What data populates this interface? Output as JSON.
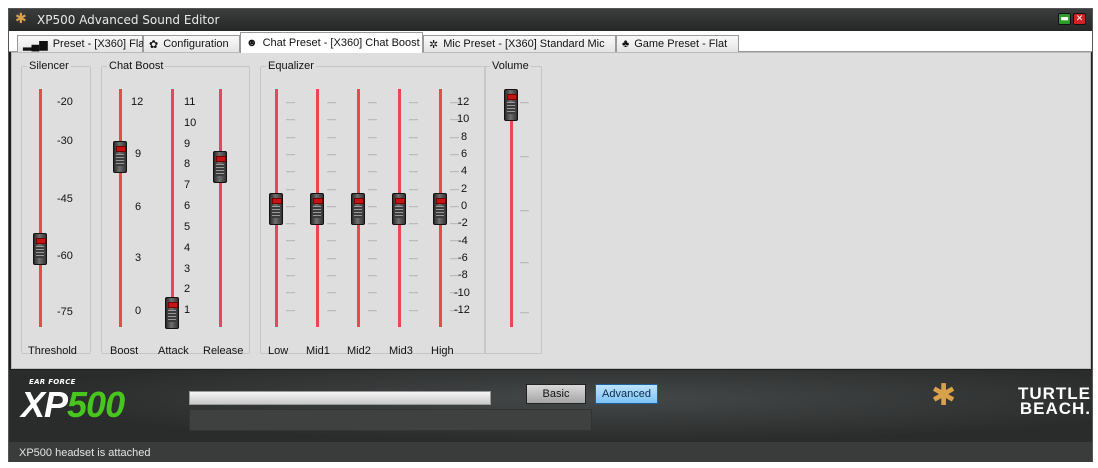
{
  "window": {
    "title": "XP500 Advanced Sound Editor",
    "app_icon": "palm-tree-icon",
    "minimize_icon": "minimize-icon",
    "close_icon": "close-icon",
    "close_glyph": "✕",
    "min_glyph": "▬"
  },
  "tabs": [
    {
      "label": "Preset - [X360] Flat",
      "icon": "equalizer-bars-icon",
      "glyph": "▂▄▆",
      "active": false
    },
    {
      "label": "Configuration",
      "icon": "gear-icon",
      "glyph": "✿",
      "active": false
    },
    {
      "label": "Chat Preset - [X360] Chat Boost",
      "icon": "head-talking-icon",
      "glyph": "☻",
      "active": true
    },
    {
      "label": "Mic Preset - [X360] Standard Mic",
      "icon": "mic-gear-icon",
      "glyph": "✲",
      "active": false
    },
    {
      "label": "Game Preset - Flat",
      "icon": "gamepad-icon",
      "glyph": "♣",
      "active": false
    }
  ],
  "silencer": {
    "legend": "Silencer",
    "ticks": [
      "-20",
      "-30",
      "-45",
      "-60",
      "-75"
    ],
    "threshold": {
      "label": "Threshold",
      "value": -58
    }
  },
  "chat_boost": {
    "legend": "Chat Boost",
    "boost_ticks": [
      "12",
      "9",
      "6",
      "3",
      "0"
    ],
    "attack_ticks": [
      "11",
      "10",
      "9",
      "8",
      "7",
      "6",
      "5",
      "4",
      "3",
      "2",
      "1"
    ],
    "boost": {
      "label": "Boost",
      "value": 9
    },
    "attack": {
      "label": "Attack",
      "value": 1
    },
    "release": {
      "label": "Release",
      "value": 8
    }
  },
  "equalizer": {
    "legend": "Equalizer",
    "ticks": [
      "12",
      "10",
      "8",
      "6",
      "4",
      "2",
      "0",
      "-2",
      "-4",
      "-6",
      "-8",
      "-10",
      "-12"
    ],
    "bands": [
      {
        "label": "Low",
        "value": 0
      },
      {
        "label": "Mid1",
        "value": 0
      },
      {
        "label": "Mid2",
        "value": 0
      },
      {
        "label": "Mid3",
        "value": 0
      },
      {
        "label": "High",
        "value": 0
      }
    ]
  },
  "volume": {
    "legend": "Volume",
    "value": 1.0
  },
  "controls": {
    "basic_label": "Basic",
    "advanced_label": "Advanced",
    "progress_fraction": 0
  },
  "branding": {
    "earforce_text": "EAR FORCE",
    "xp_text": "XP",
    "model_number": "500",
    "turtle_text": "TURTLE",
    "beach_text": "BEACH.",
    "palm_glyph": "✱"
  },
  "status": {
    "text": "XP500 headset is attached"
  }
}
